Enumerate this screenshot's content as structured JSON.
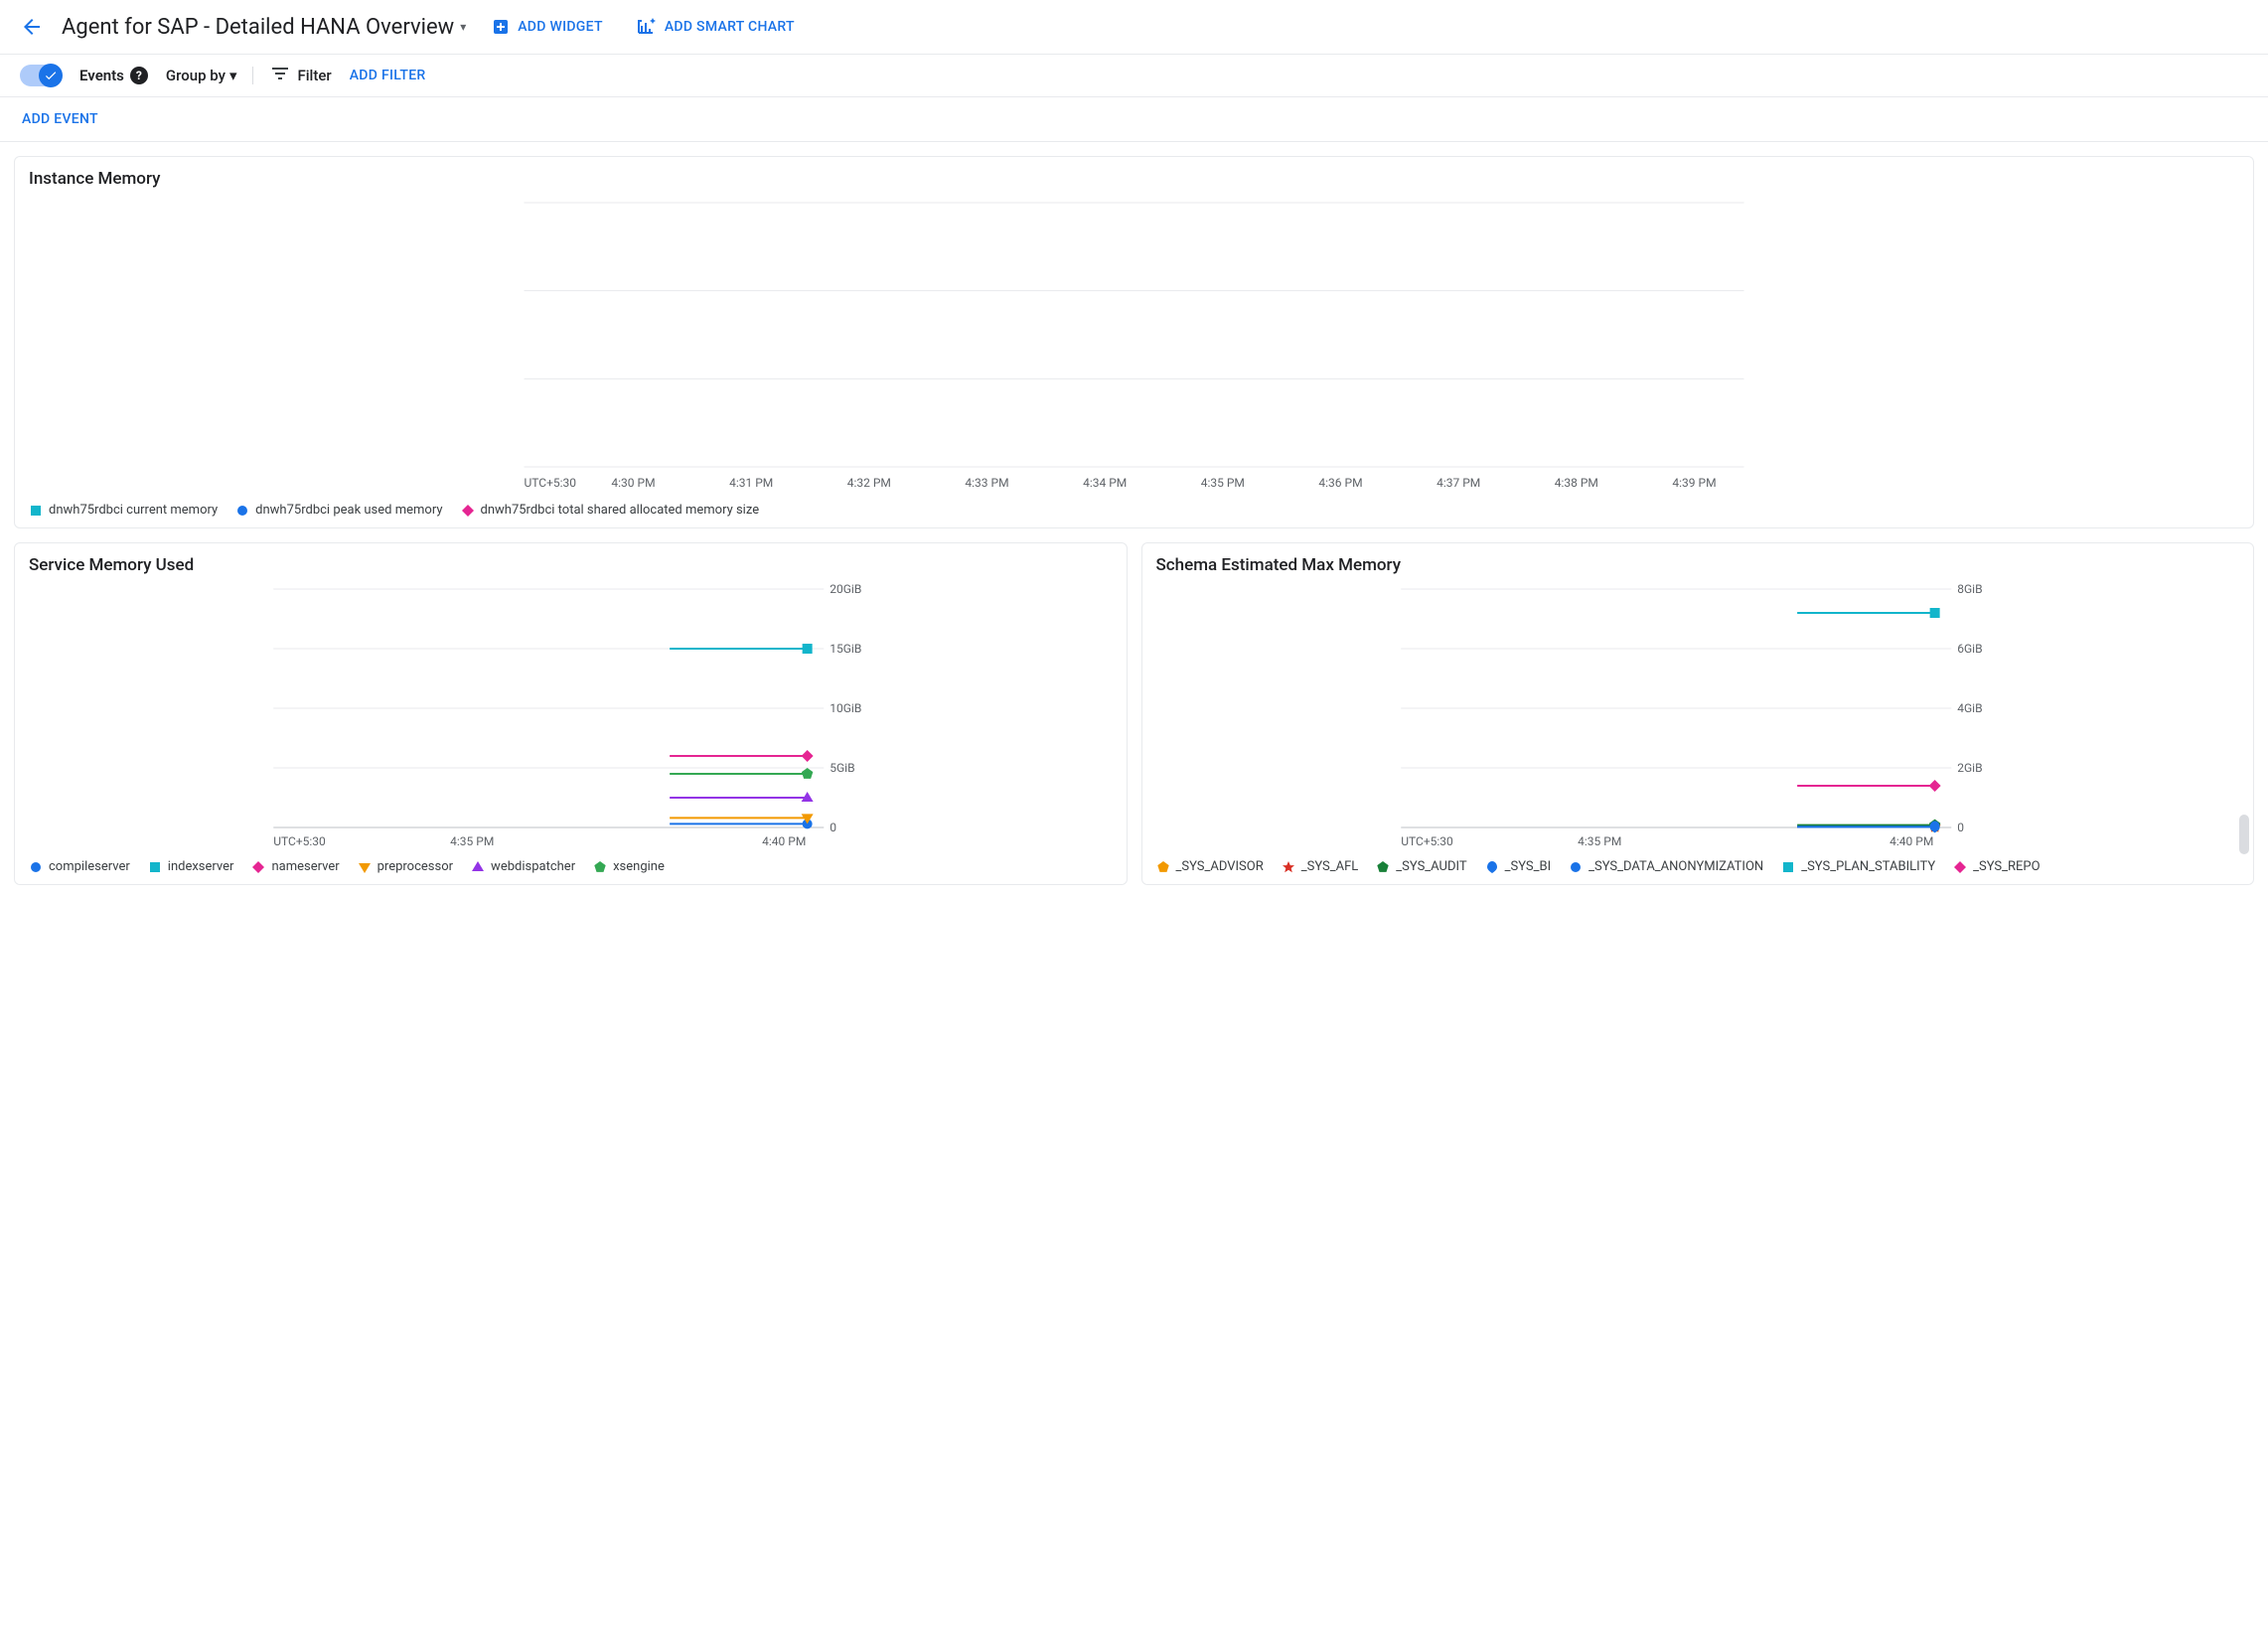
{
  "topbar": {
    "title": "Agent for SAP - Detailed HANA Overview",
    "add_widget": "ADD WIDGET",
    "add_smart_chart": "ADD SMART CHART"
  },
  "filterbar": {
    "events": "Events",
    "group_by": "Group by",
    "filter": "Filter",
    "add_filter": "ADD FILTER"
  },
  "eventbar": {
    "add_event": "ADD EVENT"
  },
  "panels": {
    "instance_memory": {
      "title": "Instance Memory"
    },
    "service_memory": {
      "title": "Service Memory Used"
    },
    "schema_max": {
      "title": "Schema Estimated Max Memory"
    }
  },
  "chart_data": [
    {
      "id": "instance_memory",
      "type": "line",
      "title": "Instance Memory",
      "timezone": "UTC+5:30",
      "x_ticks": [
        "4:30 PM",
        "4:31 PM",
        "4:32 PM",
        "4:33 PM",
        "4:34 PM",
        "4:35 PM",
        "4:36 PM",
        "4:37 PM",
        "4:38 PM",
        "4:39 PM"
      ],
      "y_ticks": [],
      "ylim": null,
      "series": [
        {
          "name": "dnwh75rdbci current memory",
          "color": "#12b5cb",
          "marker": "square",
          "values": []
        },
        {
          "name": "dnwh75rdbci peak used memory",
          "color": "#1a73e8",
          "marker": "circle",
          "values": []
        },
        {
          "name": "dnwh75rdbci total shared allocated memory size",
          "color": "#e52592",
          "marker": "diamond",
          "values": []
        }
      ]
    },
    {
      "id": "service_memory",
      "type": "line",
      "title": "Service Memory Used",
      "timezone": "UTC+5:30",
      "x_ticks": [
        "4:35 PM",
        "4:40 PM"
      ],
      "y_ticks": [
        "0",
        "5GiB",
        "10GiB",
        "15GiB",
        "20GiB"
      ],
      "ylim": [
        0,
        20
      ],
      "x_data_range": [
        "4:40 PM",
        "4:42 PM"
      ],
      "series": [
        {
          "name": "compileserver",
          "color": "#1a73e8",
          "marker": "circle",
          "value_gib": 0.3
        },
        {
          "name": "indexserver",
          "color": "#12b5cb",
          "marker": "square",
          "value_gib": 15.0
        },
        {
          "name": "nameserver",
          "color": "#e52592",
          "marker": "diamond",
          "value_gib": 6.0
        },
        {
          "name": "preprocessor",
          "color": "#f29900",
          "marker": "triangle-down",
          "value_gib": 0.8
        },
        {
          "name": "webdispatcher",
          "color": "#9334e6",
          "marker": "triangle-up",
          "value_gib": 2.5
        },
        {
          "name": "xsengine",
          "color": "#34a853",
          "marker": "pentagon",
          "value_gib": 4.5
        }
      ]
    },
    {
      "id": "schema_max",
      "type": "line",
      "title": "Schema Estimated Max Memory",
      "timezone": "UTC+5:30",
      "x_ticks": [
        "4:35 PM",
        "4:40 PM"
      ],
      "y_ticks": [
        "0",
        "2GiB",
        "4GiB",
        "6GiB",
        "8GiB"
      ],
      "ylim": [
        0,
        8
      ],
      "x_data_range": [
        "4:40 PM",
        "4:42 PM"
      ],
      "series": [
        {
          "name": "_SYS_ADVISOR",
          "color": "#f29900",
          "marker": "pentagon",
          "value_gib": 0.02
        },
        {
          "name": "_SYS_AFL",
          "color": "#d93025",
          "marker": "star",
          "value_gib": 0.02
        },
        {
          "name": "_SYS_AUDIT",
          "color": "#188038",
          "marker": "pentagon",
          "value_gib": 0.08
        },
        {
          "name": "_SYS_BI",
          "color": "#1a73e8",
          "marker": "teardrop",
          "value_gib": 0.02
        },
        {
          "name": "_SYS_DATA_ANONYMIZATION",
          "color": "#1a73e8",
          "marker": "circle",
          "value_gib": 0.02
        },
        {
          "name": "_SYS_PLAN_STABILITY",
          "color": "#12b5cb",
          "marker": "square",
          "value_gib": 7.2
        },
        {
          "name": "_SYS_REPO",
          "color": "#e52592",
          "marker": "diamond",
          "value_gib": 1.4
        }
      ]
    }
  ]
}
